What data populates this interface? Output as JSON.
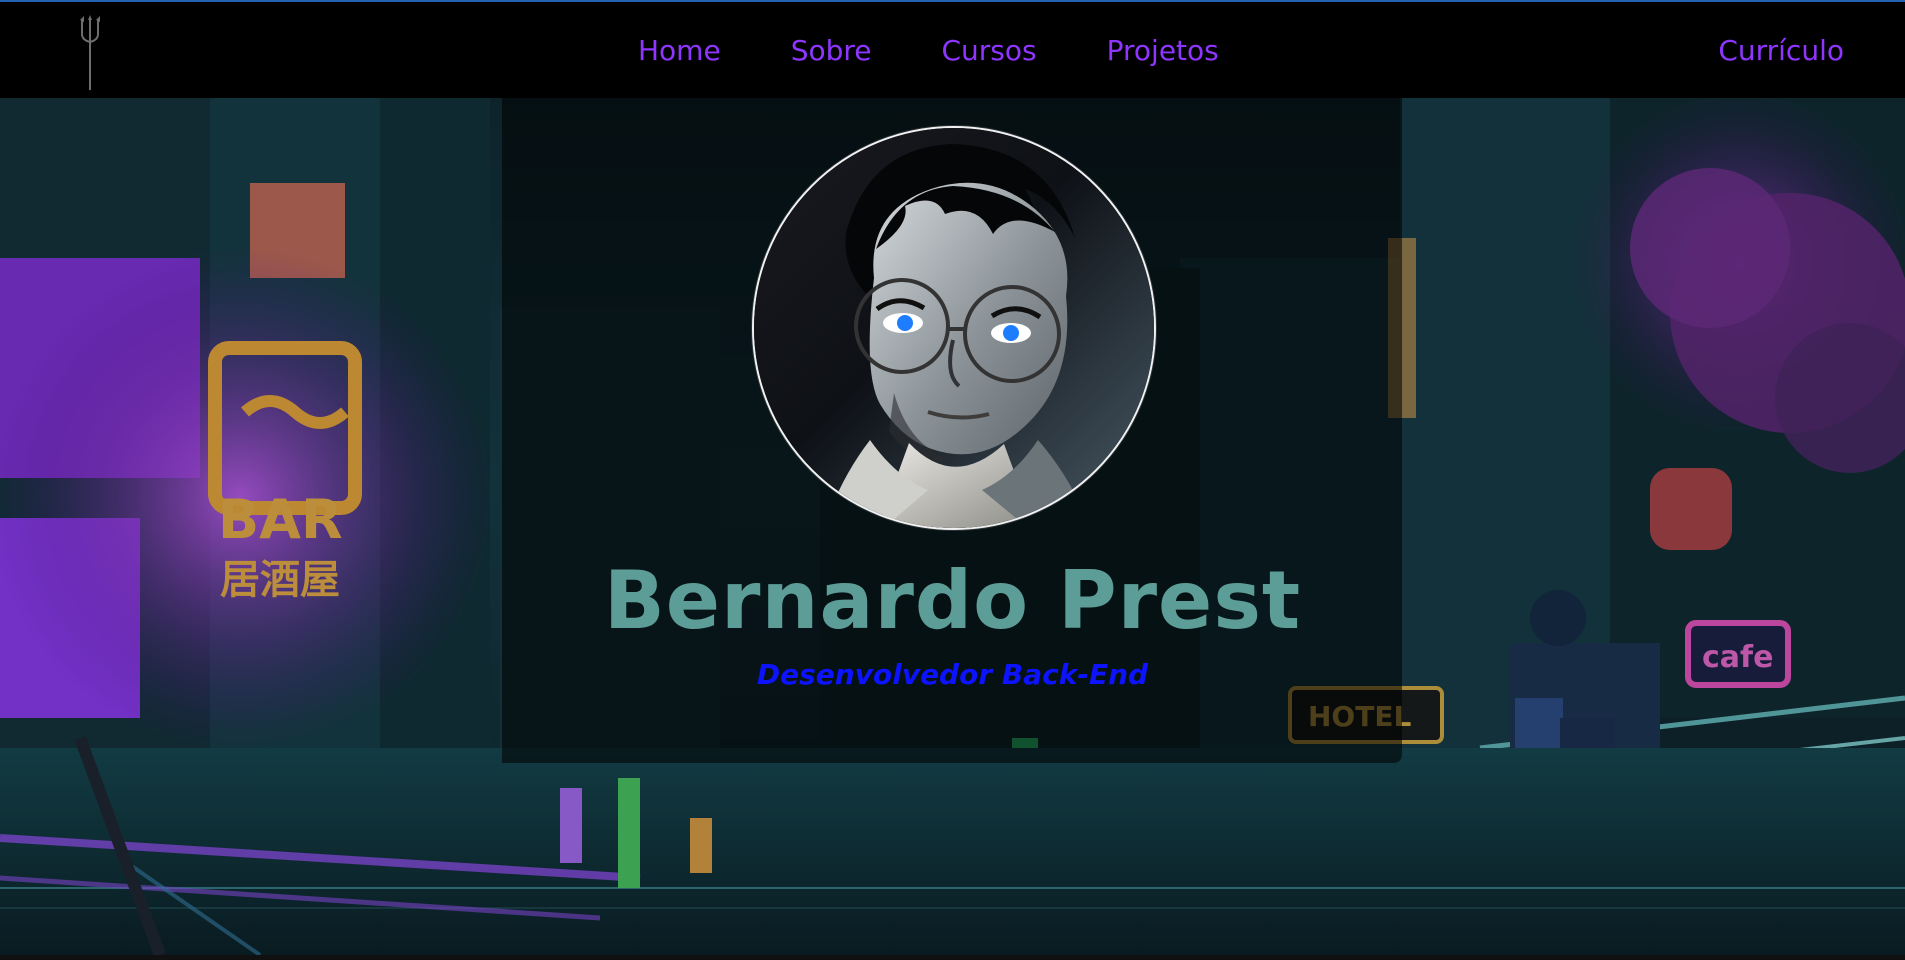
{
  "navbar": {
    "links": [
      "Home",
      "Sobre",
      "Cursos",
      "Projetos"
    ],
    "resume_label": "Currículo"
  },
  "hero": {
    "name": "Bernardo Prest",
    "role": "Desenvolvedor Back-End"
  },
  "icons": {
    "logo": "trident-icon"
  },
  "colors": {
    "top_border": "#2463b3",
    "nav_link": "#8e35ff",
    "name": "#5d9d98",
    "role": "#0d13ff"
  }
}
